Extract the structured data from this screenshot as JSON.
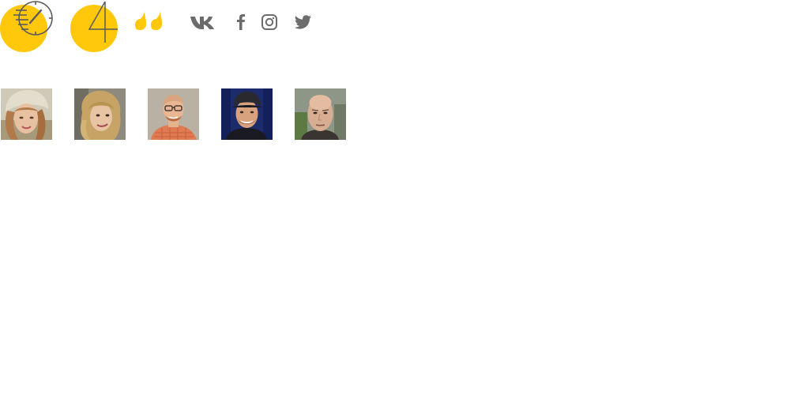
{
  "icons": {
    "speed": "speedometer-icon",
    "number": "4",
    "quote": "quote-icon"
  },
  "social": [
    {
      "name": "vk-icon"
    },
    {
      "name": "facebook-icon"
    },
    {
      "name": "instagram-icon"
    },
    {
      "name": "twitter-icon"
    }
  ],
  "colors": {
    "accent": "#FFC80A",
    "icon_gray": "#5a5a5a",
    "social_gray": "#6b6b6b"
  },
  "avatars": [
    {
      "name": "avatar-woman-hat"
    },
    {
      "name": "avatar-woman-curly-hair"
    },
    {
      "name": "avatar-man-glasses"
    },
    {
      "name": "avatar-man-cap"
    },
    {
      "name": "avatar-man-bald"
    }
  ]
}
